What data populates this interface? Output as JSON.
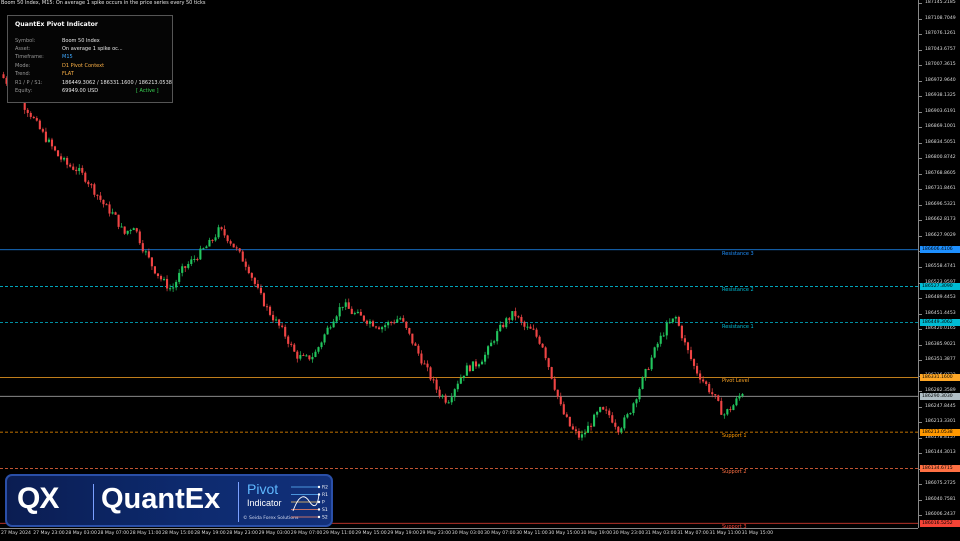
{
  "window": {
    "title": "Boom 50 Index, M15:  On average 1 spike occurs in the price series every 50 ticks"
  },
  "panel": {
    "title": "QuantEx Pivot Indicator",
    "rows": [
      {
        "label": "Symbol:",
        "value": "Boom 50 Index",
        "color": "#e8e8e8"
      },
      {
        "label": "Asset:",
        "value": "On average 1 spike oc...",
        "color": "#e8e8e8"
      },
      {
        "label": "Timeframe:",
        "value": "M15",
        "color": "#3fa9ff"
      },
      {
        "label": "Mode:",
        "value": "D1 Pivot Context",
        "color": "#ffb347"
      },
      {
        "label": "Trend:",
        "value": "FLAT",
        "color": "#ffb347"
      },
      {
        "label": "R1 / P / S1:",
        "value": "186449.3062 / 186331.1600 / 186213.0538",
        "color": "#e8e8e8"
      },
      {
        "label": "Equity:",
        "value": "69949.00 USD",
        "color": "#e8e8e8"
      }
    ],
    "status": "[ Active ]",
    "status_color": "#39d353"
  },
  "price_axis": {
    "ticks": [
      "187145.2185",
      "187108.7049",
      "187076.1261",
      "187043.6757",
      "187007.3615",
      "186972.9640",
      "186938.1325",
      "186903.6191",
      "186869.1001",
      "186834.5051",
      "186800.8742",
      "186768.8605",
      "186731.8461",
      "186696.5321",
      "186662.8173",
      "186627.9029",
      "186592.9885",
      "186558.4741",
      "186523.9597",
      "186489.4453",
      "186451.4453",
      "186420.0165",
      "186385.9021",
      "186351.3877",
      "186316.8733",
      "186282.3589",
      "186247.8445",
      "186213.3301",
      "186178.8157",
      "186144.3013",
      "186109.7869",
      "186075.2725",
      "186040.7581",
      "186006.2437"
    ],
    "tags": [
      {
        "text": "186606.4106",
        "color": "#1e90ff"
      },
      {
        "text": "186527.3090",
        "color": "#00bcd4"
      },
      {
        "text": "186449.3062",
        "color": "#00bcd4"
      },
      {
        "text": "186331.1600",
        "color": "#ffa726"
      },
      {
        "text": "186290.3030",
        "color": "#b0bec5"
      },
      {
        "text": "186213.0538",
        "color": "#ff9800"
      },
      {
        "text": "186134.6715",
        "color": "#ff7043"
      },
      {
        "text": "186016.5252",
        "color": "#f44336"
      }
    ]
  },
  "levels": [
    {
      "name": "Resistance 3",
      "price": 186606.4106,
      "color": "#1e90ff",
      "style": "solid"
    },
    {
      "name": "Resistance 2",
      "price": 186527.309,
      "color": "#00bcd4",
      "style": "dashed"
    },
    {
      "name": "Resistance 1",
      "price": 186449.3062,
      "color": "#00bcd4",
      "style": "dashed"
    },
    {
      "name": "Pivot Level",
      "price": 186331.16,
      "color": "#ffa726",
      "style": "solid"
    },
    {
      "name": "",
      "price": 186290.303,
      "color": "#9e9e9e",
      "style": "solid"
    },
    {
      "name": "Support 1",
      "price": 186213.0538,
      "color": "#ff9800",
      "style": "dashed"
    },
    {
      "name": "Support 2",
      "price": 186134.6715,
      "color": "#ff7043",
      "style": "dashed"
    },
    {
      "name": "Support 3",
      "price": 186016.5252,
      "color": "#f44336",
      "style": "solid"
    }
  ],
  "time_axis": {
    "ticks": [
      "27 May 2024",
      "27 May 23:00",
      "28 May 03:00",
      "28 May 07:00",
      "28 May 11:00",
      "28 May 15:00",
      "28 May 19:00",
      "28 May 23:00",
      "29 May 03:00",
      "29 May 07:00",
      "29 May 11:00",
      "29 May 15:00",
      "29 May 19:00",
      "29 May 23:00",
      "30 May 03:00",
      "30 May 07:00",
      "30 May 11:00",
      "30 May 15:00",
      "30 May 19:00",
      "30 May 23:00",
      "31 May 03:00",
      "31 May 07:00",
      "31 May 11:00",
      "31 May 15:00"
    ]
  },
  "logo": {
    "mark": "QX",
    "name": "QuantEx",
    "product": "Pivot",
    "product_sub": "Indicator",
    "credit": "© Seida Forex Solutions",
    "diagram_labels": [
      "R2",
      "R1",
      "P",
      "S1",
      "S2"
    ]
  },
  "colors": {
    "bull": "#22c55e",
    "bear": "#ef4444",
    "background": "#000000"
  },
  "chart_data": {
    "type": "candlestick",
    "symbol": "Boom 50 Index",
    "timeframe": "M15",
    "ylim": [
      186006.2437,
      187145.2185
    ],
    "path_closes": [
      186985,
      186960,
      186930,
      186905,
      186870,
      186840,
      186810,
      186790,
      186780,
      186760,
      186730,
      186700,
      186680,
      186640,
      186660,
      186610,
      186570,
      186540,
      186520,
      186560,
      186580,
      186600,
      186620,
      186650,
      186630,
      186600,
      186570,
      186520,
      186480,
      186450,
      186420,
      186380,
      186370,
      186380,
      186420,
      186460,
      186490,
      186470,
      186460,
      186450,
      186440,
      186450,
      186460,
      186420,
      186380,
      186340,
      186300,
      186280,
      186320,
      186350,
      186360,
      186380,
      186420,
      186450,
      186470,
      186440,
      186430,
      186400,
      186330,
      186260,
      186220,
      186200,
      186230,
      186260,
      186250,
      186220,
      186250,
      186300,
      186350,
      186400,
      186440,
      186460,
      186400,
      186350,
      186320,
      186290,
      186250,
      186270,
      186300
    ]
  }
}
